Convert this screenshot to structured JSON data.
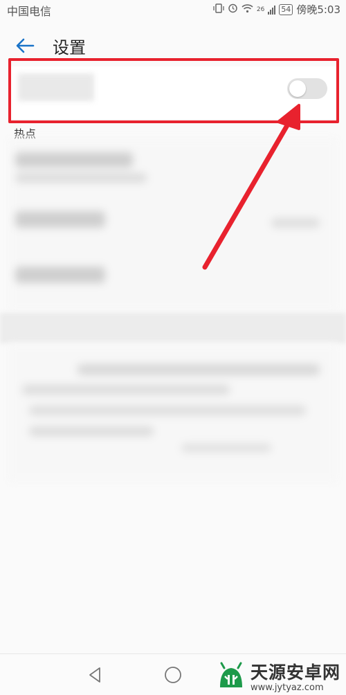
{
  "status_bar": {
    "carrier": "中国电信",
    "network": "26",
    "battery": "54",
    "time": "傍晚5:03"
  },
  "header": {
    "title": "设置"
  },
  "hotspot": {
    "toggle_on": false,
    "section_label": "热点"
  },
  "annotation": {
    "color": "#e8222e"
  },
  "watermark": {
    "brand": "天源安卓网",
    "url": "www.jytyaz.com"
  },
  "colors": {
    "accent": "#1a73c8",
    "annotation": "#e8222e",
    "logo_green": "#1d9a4a"
  }
}
